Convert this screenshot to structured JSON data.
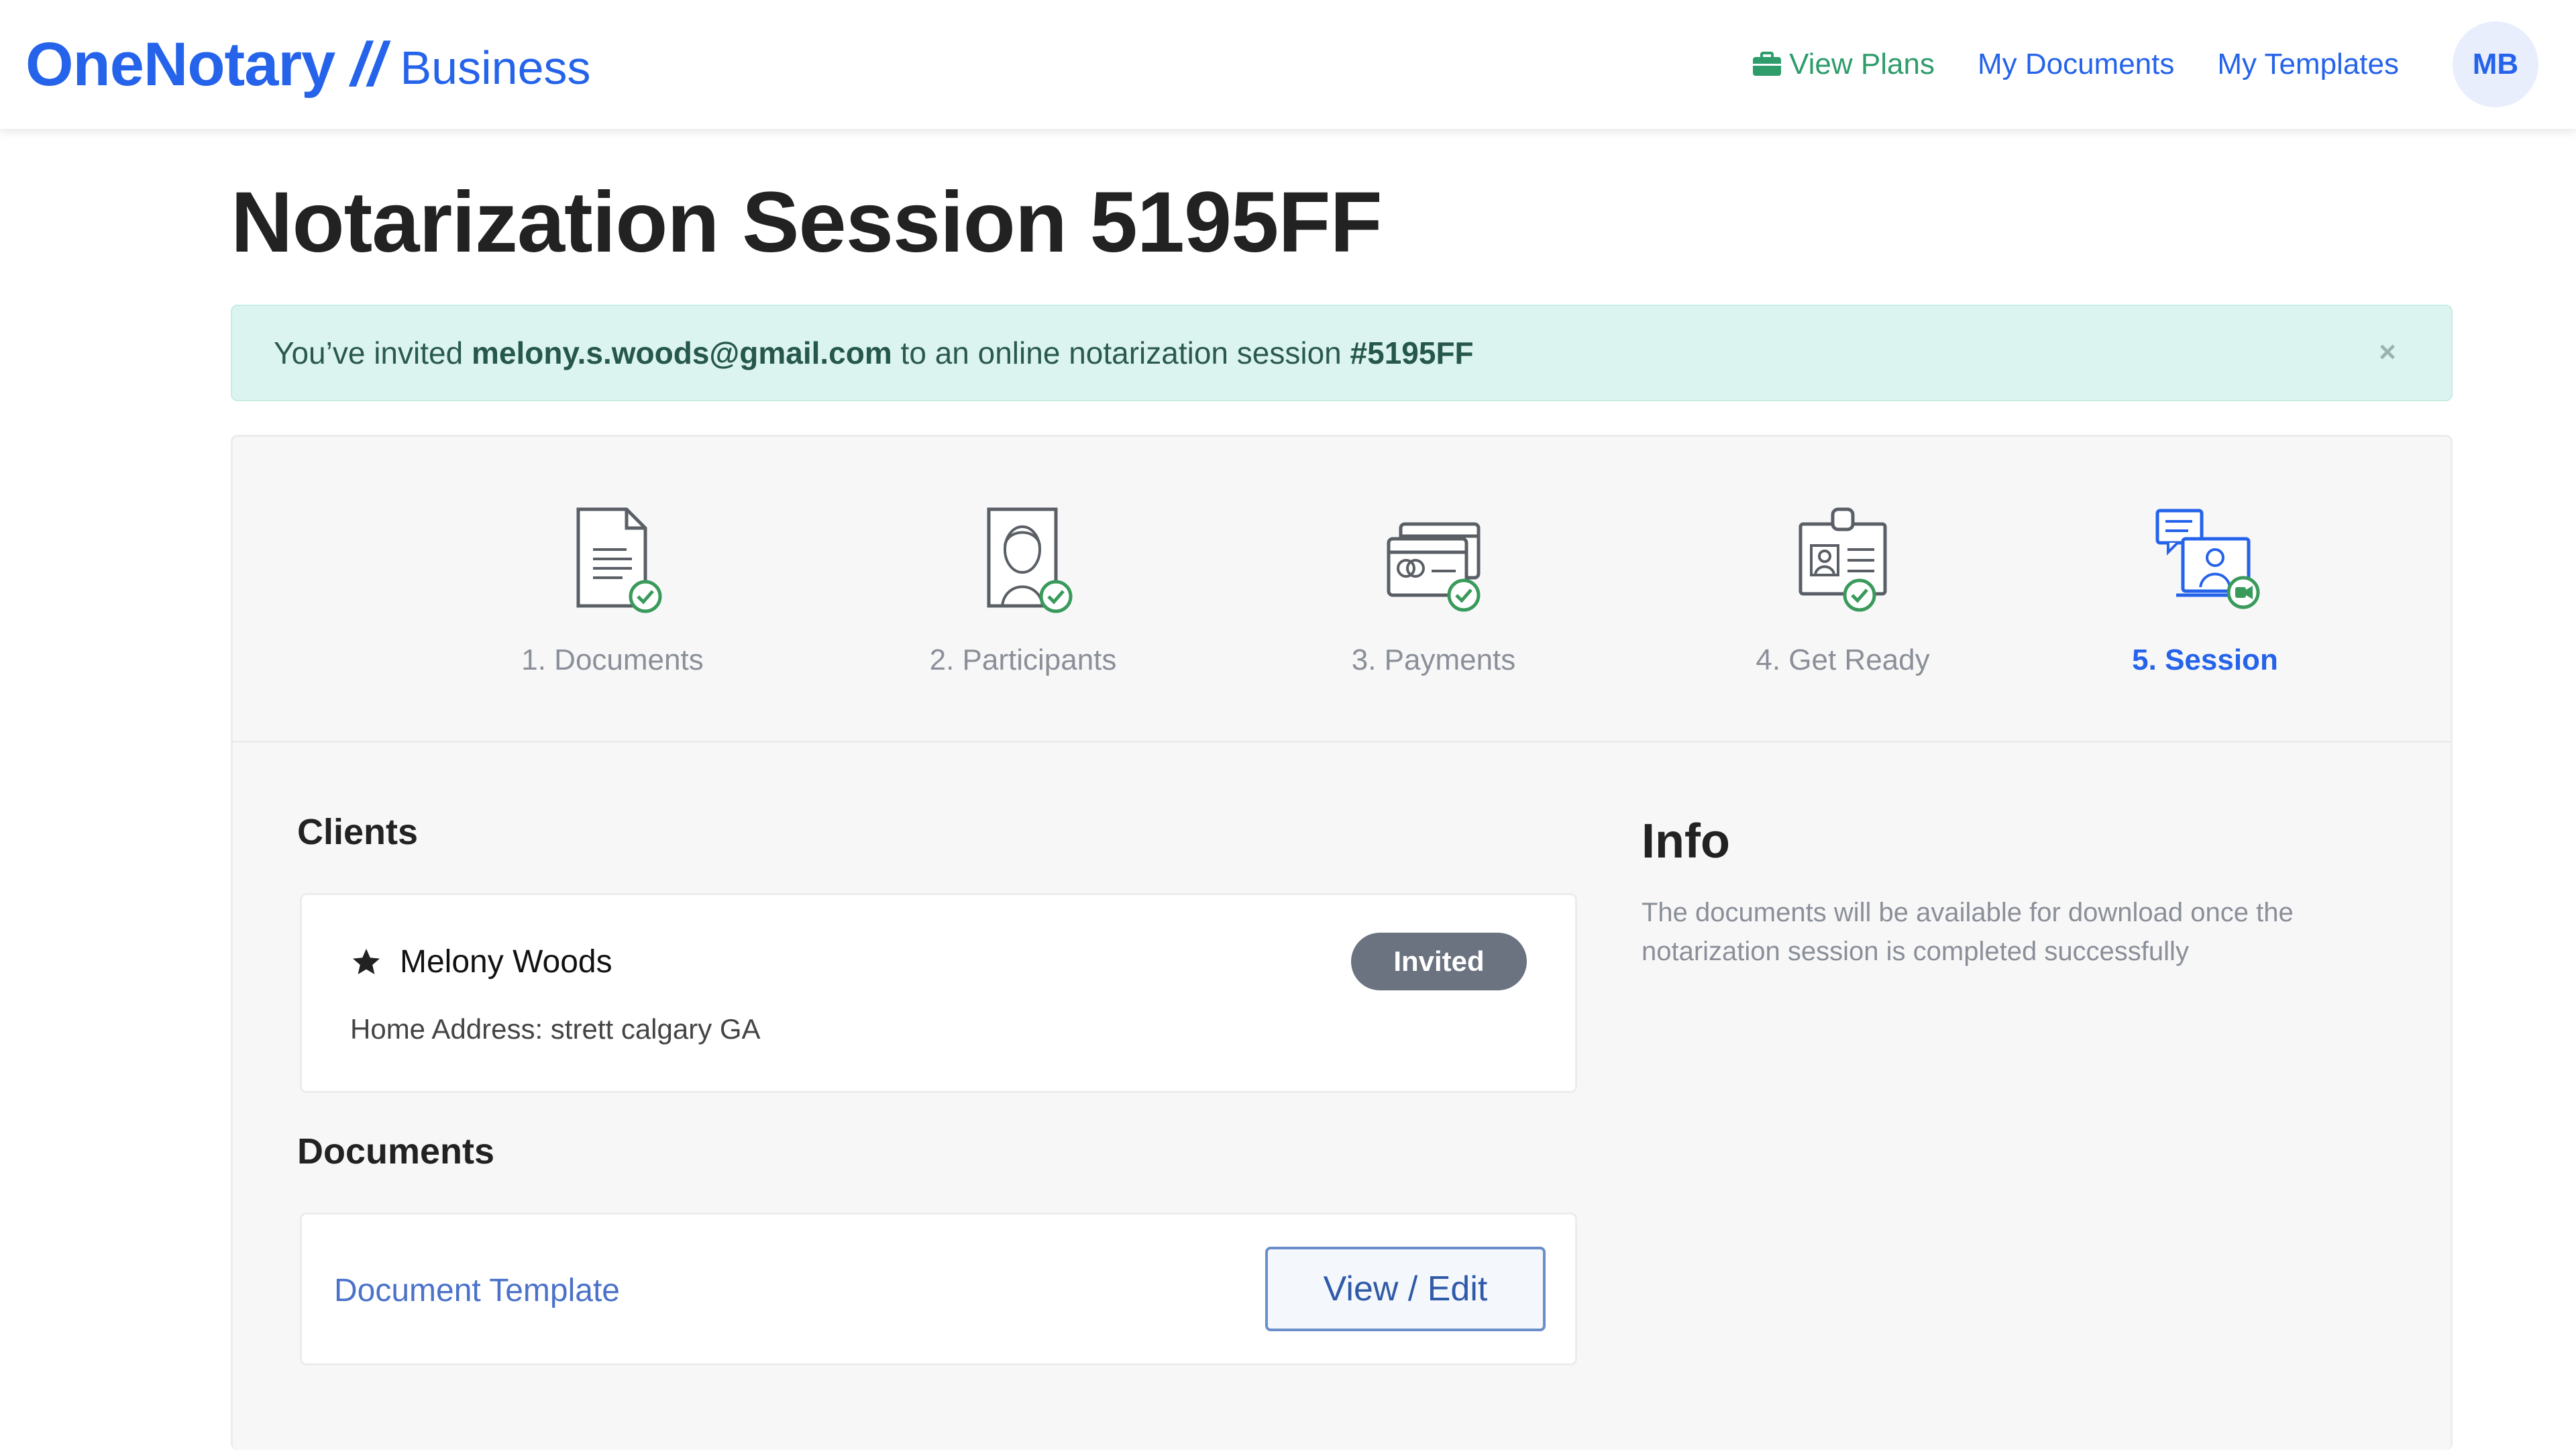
{
  "header": {
    "brand": "OneNotary",
    "separator": "//",
    "product": "Business",
    "nav": {
      "view_plans": "View Plans",
      "my_documents": "My Documents",
      "my_templates": "My Templates"
    },
    "avatar_initials": "MB"
  },
  "page": {
    "title": "Notarization Session 5195FF"
  },
  "alert": {
    "prefix": "You’ve invited ",
    "email": "melony.s.woods@gmail.com",
    "middle": " to an online notarization session ",
    "session_id": "#5195FF",
    "close": "×"
  },
  "steps": [
    {
      "label": "1. Documents",
      "icon": "document-icon",
      "complete": true
    },
    {
      "label": "2. Participants",
      "icon": "participant-icon",
      "complete": true
    },
    {
      "label": "3. Payments",
      "icon": "credit-card-icon",
      "complete": true
    },
    {
      "label": "4. Get Ready",
      "icon": "id-badge-icon",
      "complete": true
    },
    {
      "label": "5. Session",
      "icon": "video-session-icon",
      "active": true
    }
  ],
  "clients": {
    "heading": "Clients",
    "items": [
      {
        "name": "Melony Woods",
        "address": "Home Address: strett calgary GA",
        "status": "Invited"
      }
    ]
  },
  "documents": {
    "heading": "Documents",
    "items": [
      {
        "name": "Document Template",
        "action": "View / Edit"
      }
    ]
  },
  "info": {
    "heading": "Info",
    "text": "The documents will be available for download once the notarization session is completed successfully"
  },
  "colors": {
    "brand_blue": "#2563eb",
    "plans_green": "#2e9c6b",
    "alert_bg": "#dcf4ef",
    "check_green": "#3a9a5b",
    "badge_gray": "#6b7280"
  }
}
